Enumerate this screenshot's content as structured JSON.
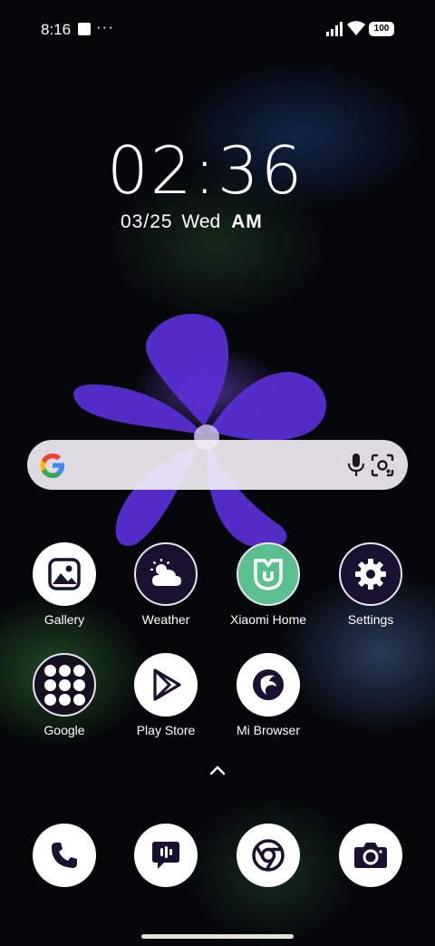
{
  "status_bar": {
    "time": "8:16",
    "more_dots": "···",
    "battery": "100"
  },
  "lock_clock": {
    "time": "02:36",
    "date": "03/25",
    "weekday": "Wed",
    "ampm": "AM"
  },
  "search_bar": {
    "logo_icon": "google-g-icon",
    "mic_icon": "mic-icon",
    "lens_icon": "lens-icon"
  },
  "apps_row1": [
    {
      "label": "Gallery",
      "icon": "gallery-icon"
    },
    {
      "label": "Weather",
      "icon": "weather-icon"
    },
    {
      "label": "Xiaomi Home",
      "icon": "xiaomi-home-icon"
    },
    {
      "label": "Settings",
      "icon": "gear-icon"
    }
  ],
  "apps_row2": [
    {
      "label": "Google",
      "icon": "google-folder-icon"
    },
    {
      "label": "Play Store",
      "icon": "play-store-icon"
    },
    {
      "label": "Mi Browser",
      "icon": "mi-browser-icon"
    }
  ],
  "dock": [
    {
      "icon": "phone-icon"
    },
    {
      "icon": "messages-icon"
    },
    {
      "icon": "chrome-icon"
    },
    {
      "icon": "camera-icon"
    }
  ],
  "colors": {
    "icon_fg": "#1a1030",
    "xiaomi_green": "#5bc08e",
    "search_bg": "#f0eef4"
  }
}
